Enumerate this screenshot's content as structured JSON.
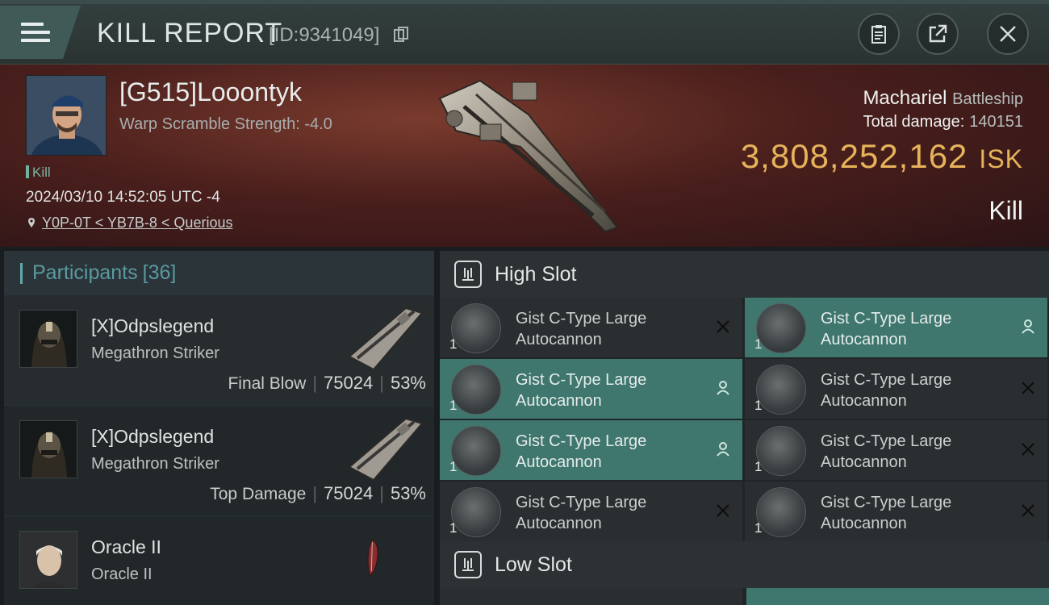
{
  "header": {
    "title": "KILL REPORT",
    "report_id": "[ID:9341049]",
    "buttons": [
      "clipboard-icon",
      "share-icon",
      "close-icon"
    ]
  },
  "victim": {
    "name": "[G515]Looontyk",
    "scramble": "Warp Scramble Strength: -4.0",
    "tag": "Kill",
    "timestamp": "2024/03/10 14:52:05 UTC -4",
    "location": "Y0P-0T < YB7B-8 < Querious",
    "ship": "Machariel",
    "ship_class": "Battleship",
    "damage_label": "Total damage:",
    "damage_value": "140151",
    "isk_value": "3,808,252,162",
    "isk_unit": "ISK",
    "result": "Kill"
  },
  "participants": {
    "label": "Participants",
    "count": "[36]",
    "rows": [
      {
        "name": "[X]Odpslegend",
        "ship": "Megathron Striker",
        "stat_label": "Final Blow",
        "damage": "75024",
        "percent": "53%"
      },
      {
        "name": "[X]Odpslegend",
        "ship": "Megathron Striker",
        "stat_label": "Top Damage",
        "damage": "75024",
        "percent": "53%"
      },
      {
        "name": "Oracle II",
        "ship": "Oracle II",
        "stat_label": "",
        "damage": "",
        "percent": ""
      }
    ]
  },
  "slots": {
    "high_label": "High Slot",
    "low_label": "Low Slot",
    "modules": [
      {
        "name_line1": "Gist C-Type Large",
        "name_line2": "Autocannon",
        "qty": "1",
        "state": "destroyed"
      },
      {
        "name_line1": "Gist C-Type Large",
        "name_line2": "Autocannon",
        "qty": "1",
        "state": "dropped"
      },
      {
        "name_line1": "Gist C-Type Large",
        "name_line2": "Autocannon",
        "qty": "1",
        "state": "dropped"
      },
      {
        "name_line1": "Gist C-Type Large",
        "name_line2": "Autocannon",
        "qty": "1",
        "state": "destroyed"
      },
      {
        "name_line1": "Gist C-Type Large",
        "name_line2": "Autocannon",
        "qty": "1",
        "state": "dropped"
      },
      {
        "name_line1": "Gist C-Type Large",
        "name_line2": "Autocannon",
        "qty": "1",
        "state": "destroyed"
      },
      {
        "name_line1": "Gist C-Type Large",
        "name_line2": "Autocannon",
        "qty": "1",
        "state": "destroyed"
      },
      {
        "name_line1": "Gist C-Type Large",
        "name_line2": "Autocannon",
        "qty": "1",
        "state": "destroyed"
      }
    ]
  },
  "colors": {
    "accent": "#3f766e",
    "isk": "#e6b35a",
    "participants_label": "#5a9aa0"
  }
}
